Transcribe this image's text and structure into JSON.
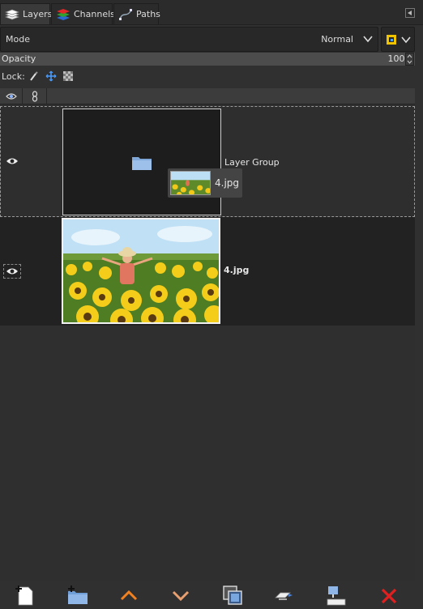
{
  "tabs": [
    {
      "label": "Layers",
      "icon": "layers-icon",
      "active": true
    },
    {
      "label": "Channels",
      "icon": "channels-icon",
      "active": false
    },
    {
      "label": "Paths",
      "icon": "paths-icon",
      "active": false
    }
  ],
  "mode": {
    "label": "Mode",
    "value": "Normal"
  },
  "opacity": {
    "label": "Opacity",
    "value": "100,0"
  },
  "lock": {
    "label": "Lock:"
  },
  "layers": [
    {
      "name": "Layer Group",
      "type": "group",
      "visible": true
    },
    {
      "name": "4.jpg",
      "type": "image",
      "visible": true
    }
  ],
  "drag_tooltip": {
    "label": "4.jpg"
  },
  "toolbar_buttons": [
    "new-layer-icon",
    "new-layer-group-icon",
    "raise-layer-icon",
    "lower-layer-icon",
    "duplicate-layer-icon",
    "anchor-layer-icon",
    "merge-layer-icon",
    "delete-layer-icon"
  ],
  "colors": {
    "panel": "#303030",
    "selection_accent": "#f0c400",
    "delete": "#e02020",
    "arrows": "#f08020"
  }
}
